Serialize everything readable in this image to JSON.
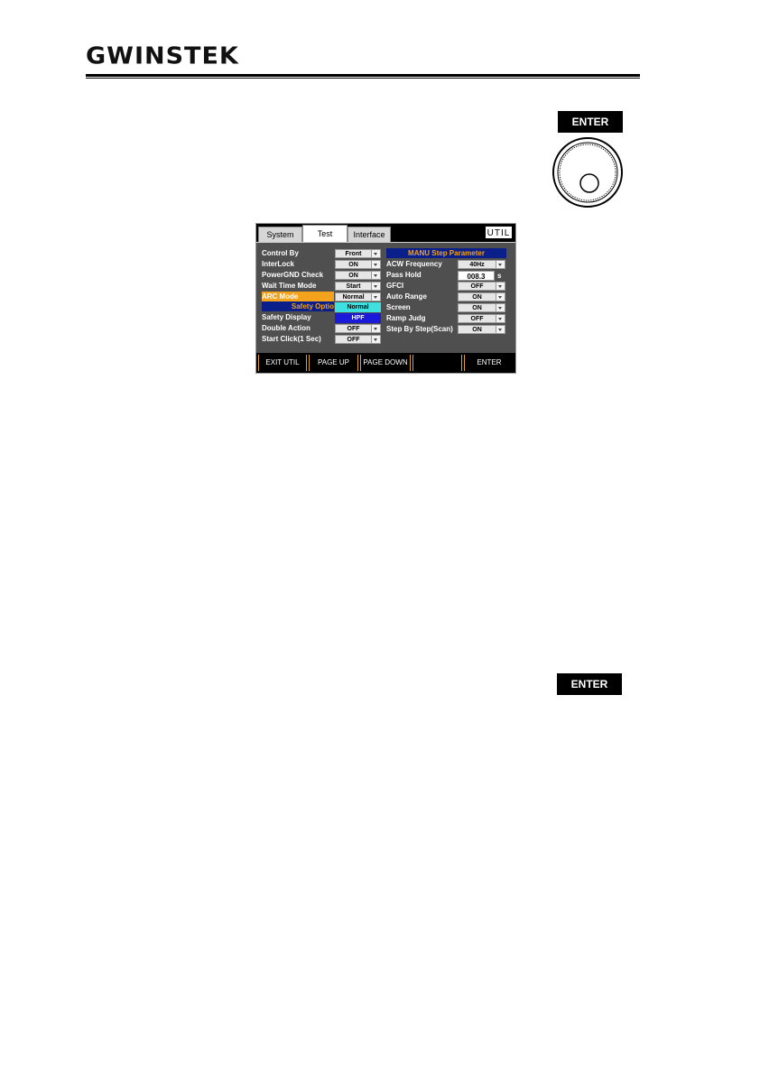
{
  "header": {
    "logo_text": "GWINSTEK"
  },
  "hardware": {
    "enter_top_label": "ENTER",
    "enter_bottom_label": "ENTER"
  },
  "screen": {
    "tabs": [
      {
        "label": "System"
      },
      {
        "label": "Test"
      },
      {
        "label": "Interface"
      }
    ],
    "active_tab": "Test",
    "util_label": "UTIL",
    "left_rows": [
      {
        "label": "Control By",
        "value": "Front"
      },
      {
        "label": "InterLock",
        "value": "ON"
      },
      {
        "label": "PowerGND Check",
        "value": "ON"
      },
      {
        "label": "Wait Time Mode",
        "value": "Start"
      },
      {
        "label": "ARC Mode",
        "value": "Normal"
      },
      {
        "label": "Safety Display"
      },
      {
        "label": "Double Action",
        "value": "OFF"
      },
      {
        "label": "Start Click(1 Sec)",
        "value": "OFF"
      }
    ],
    "safety_section_title": "Safety Optio",
    "arc_dropdown_options": [
      "Normal",
      "HPF"
    ],
    "right_section_title": "MANU Step Parameter",
    "right_rows": [
      {
        "label": "ACW Frequency",
        "value": "40Hz"
      },
      {
        "label": "Pass Hold",
        "value": "008.3",
        "unit": "s"
      },
      {
        "label": "GFCI",
        "value": "OFF"
      },
      {
        "label": "Auto Range",
        "value": "ON"
      },
      {
        "label": "Screen",
        "value": "ON"
      },
      {
        "label": "Ramp Judg",
        "value": "OFF"
      },
      {
        "label": "Step By Step(Scan)",
        "value": "ON"
      }
    ],
    "softkeys": [
      {
        "label": "EXIT UTIL"
      },
      {
        "label": "PAGE UP"
      },
      {
        "label": "PAGE DOWN"
      },
      {
        "label": ""
      },
      {
        "label": "ENTER"
      }
    ],
    "colors": {
      "highlight": "#f3a21b",
      "section_bg": "#0b1f8a",
      "option_normal": "#3fe0e0",
      "option_hpf": "#1a1ad8"
    }
  }
}
